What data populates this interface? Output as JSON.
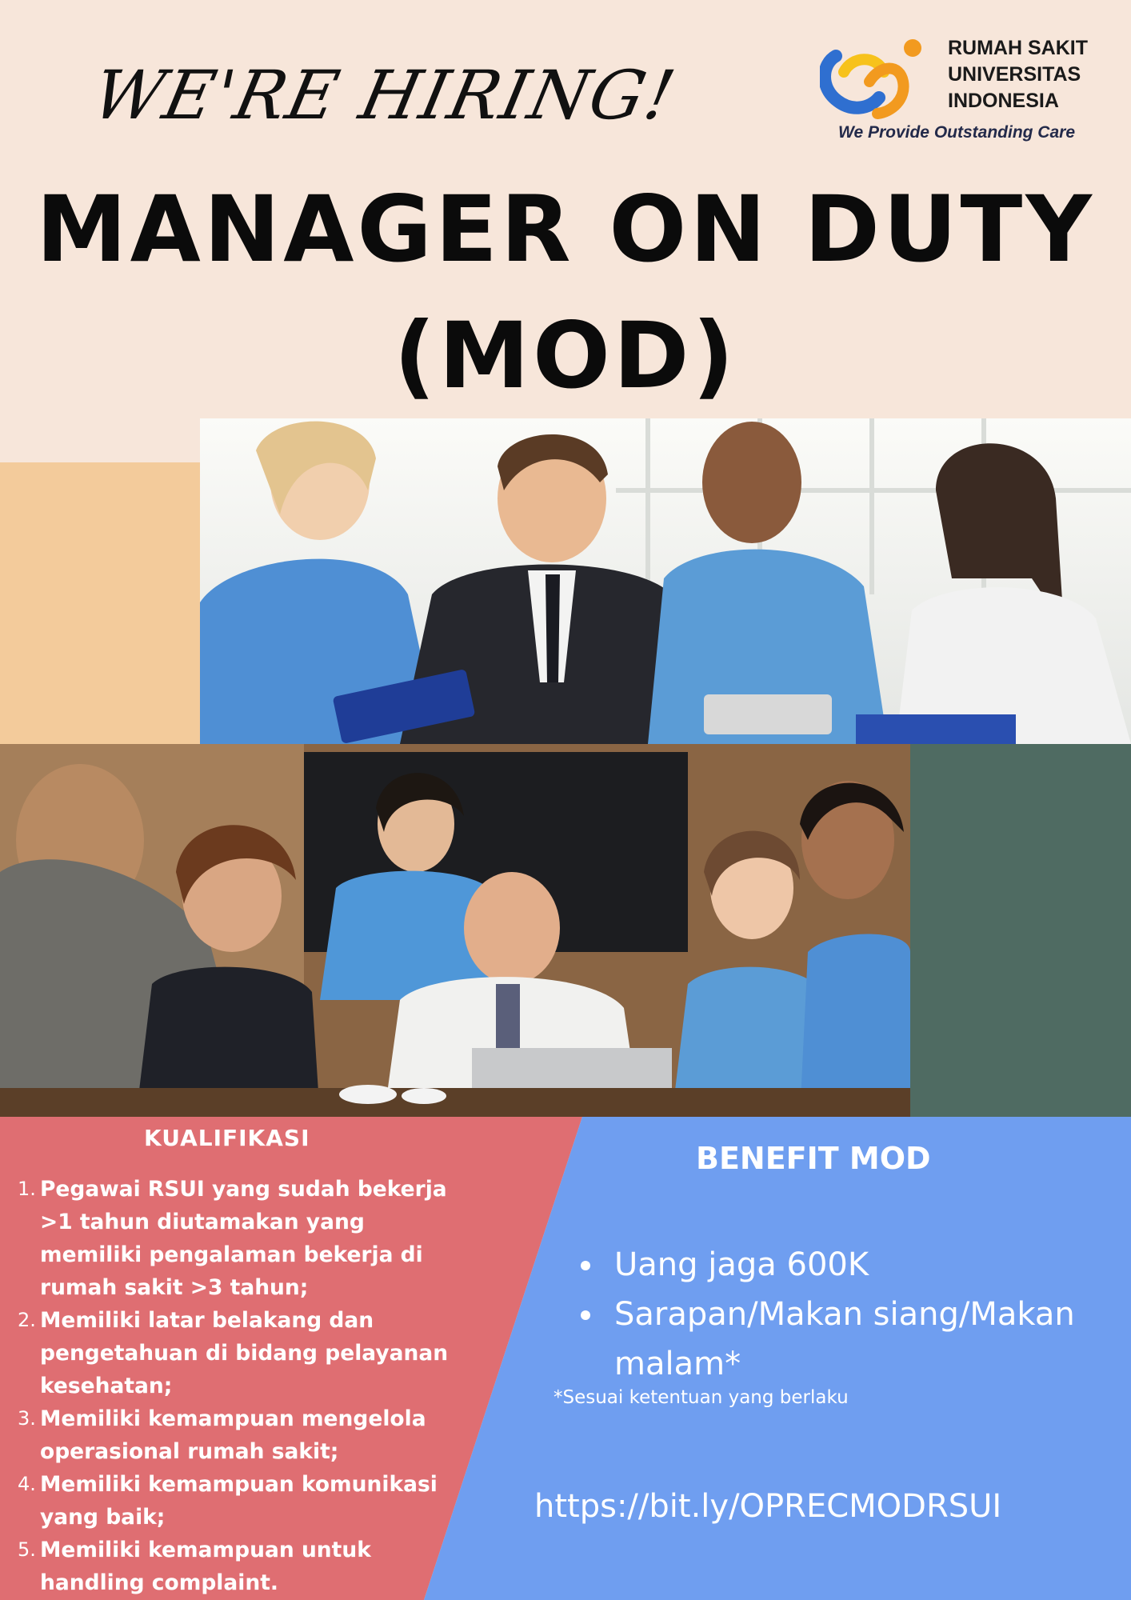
{
  "header": {
    "hiring_text": "WE'RE HIRING!",
    "title_line1": "MANAGER ON DUTY",
    "title_line2": "(MOD)"
  },
  "logo": {
    "name_line1": "RUMAH SAKIT",
    "name_line2": "UNIVERSITAS",
    "name_line3": "INDONESIA",
    "tagline": "We Provide Outstanding Care",
    "colors": {
      "blue": "#2f6fd0",
      "orange": "#f29a1f",
      "yellow": "#f7c21b"
    }
  },
  "qualifications": {
    "title": "KUALIFIKASI",
    "items": [
      {
        "num": "1.",
        "text": "Pegawai RSUI yang sudah bekerja >1 tahun diutamakan yang memiliki pengalaman bekerja di rumah sakit >3 tahun;"
      },
      {
        "num": "2.",
        "text": "Memiliki latar belakang dan pengetahuan di bidang pelayanan kesehatan;"
      },
      {
        "num": "3.",
        "text": "Memiliki kemampuan mengelola operasional rumah sakit;"
      },
      {
        "num": "4.",
        "text": "Memiliki kemampuan komunikasi yang baik;"
      },
      {
        "num": "5.",
        "text": "Memiliki kemampuan untuk handling complaint."
      }
    ]
  },
  "benefits": {
    "title": "BENEFIT MOD",
    "items": [
      "Uang jaga 600K",
      "Sarapan/Makan siang/Makan malam*"
    ],
    "note": "*Sesuai ketentuan yang berlaku"
  },
  "link": "https://bit.ly/OPRECMODRSUI",
  "colors": {
    "background": "#f7e6da",
    "peach": "#f3cb9b",
    "green": "#4f6b62",
    "red_panel": "#df6e72",
    "blue_panel": "#6f9ef0"
  }
}
